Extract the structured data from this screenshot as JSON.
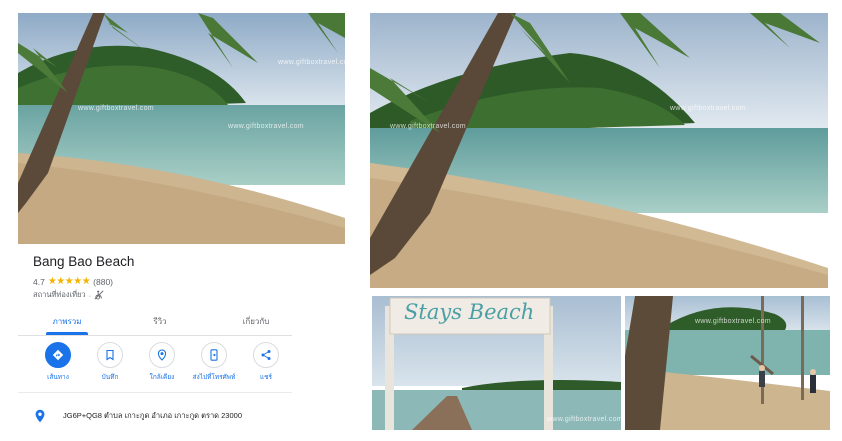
{
  "place": {
    "name": "Bang Bao Beach",
    "rating": "4.7",
    "stars_icon": "★★★★★",
    "review_count": "(880)",
    "category": "สถานที่ท่องเที่ยว",
    "category_separator": "·",
    "accessibility_icon": "wheelchair-strikethrough-icon",
    "address": "JG6P+QG8 ตำบล เกาะกูด อำเภอ เกาะกูด ตราด 23000"
  },
  "tabs": [
    {
      "label": "ภาพรวม",
      "active": true
    },
    {
      "label": "รีวิว",
      "active": false
    },
    {
      "label": "เกี่ยวกับ",
      "active": false
    }
  ],
  "actions": [
    {
      "label": "เส้นทาง",
      "icon": "directions-icon"
    },
    {
      "label": "บันทึก",
      "icon": "bookmark-icon"
    },
    {
      "label": "ใกล้เคียง",
      "icon": "nearby-icon"
    },
    {
      "label": "ส่งไปที่โทรศัพท์",
      "icon": "send-to-phone-icon"
    },
    {
      "label": "แชร์",
      "icon": "share-icon"
    }
  ],
  "watermark": "www.giftboxtravel.com",
  "sign_text": "Stays Beach",
  "colors": {
    "accent": "#1a73e8",
    "star": "#f4b400",
    "sea": "#7fb6b0",
    "sand": "#cdb590",
    "sky": "#c9d9e6",
    "island": "#2f5d2a"
  }
}
